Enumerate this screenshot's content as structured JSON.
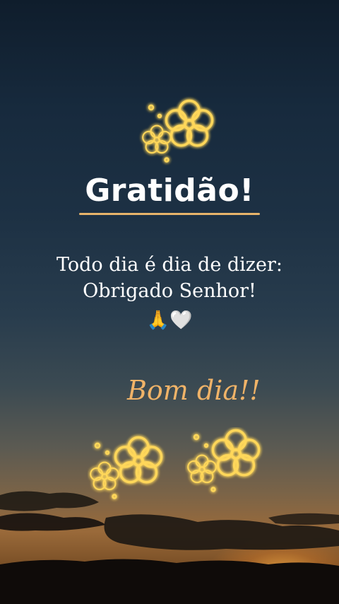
{
  "card": {
    "title": "Gratidão!",
    "message_line1": "Todo dia é dia de dizer:",
    "message_line2": "Obrigado Senhor!",
    "emoji": "🙏🤍",
    "greeting": "Bom dia!!"
  },
  "colors": {
    "title_text": "#ffffff",
    "underline": "#e7b46a",
    "greeting_text": "#f0b368",
    "flower_glow": "#ffd75a"
  },
  "icons": [
    "glowing-flower-icon",
    "praying-hands-icon",
    "white-heart-icon"
  ]
}
